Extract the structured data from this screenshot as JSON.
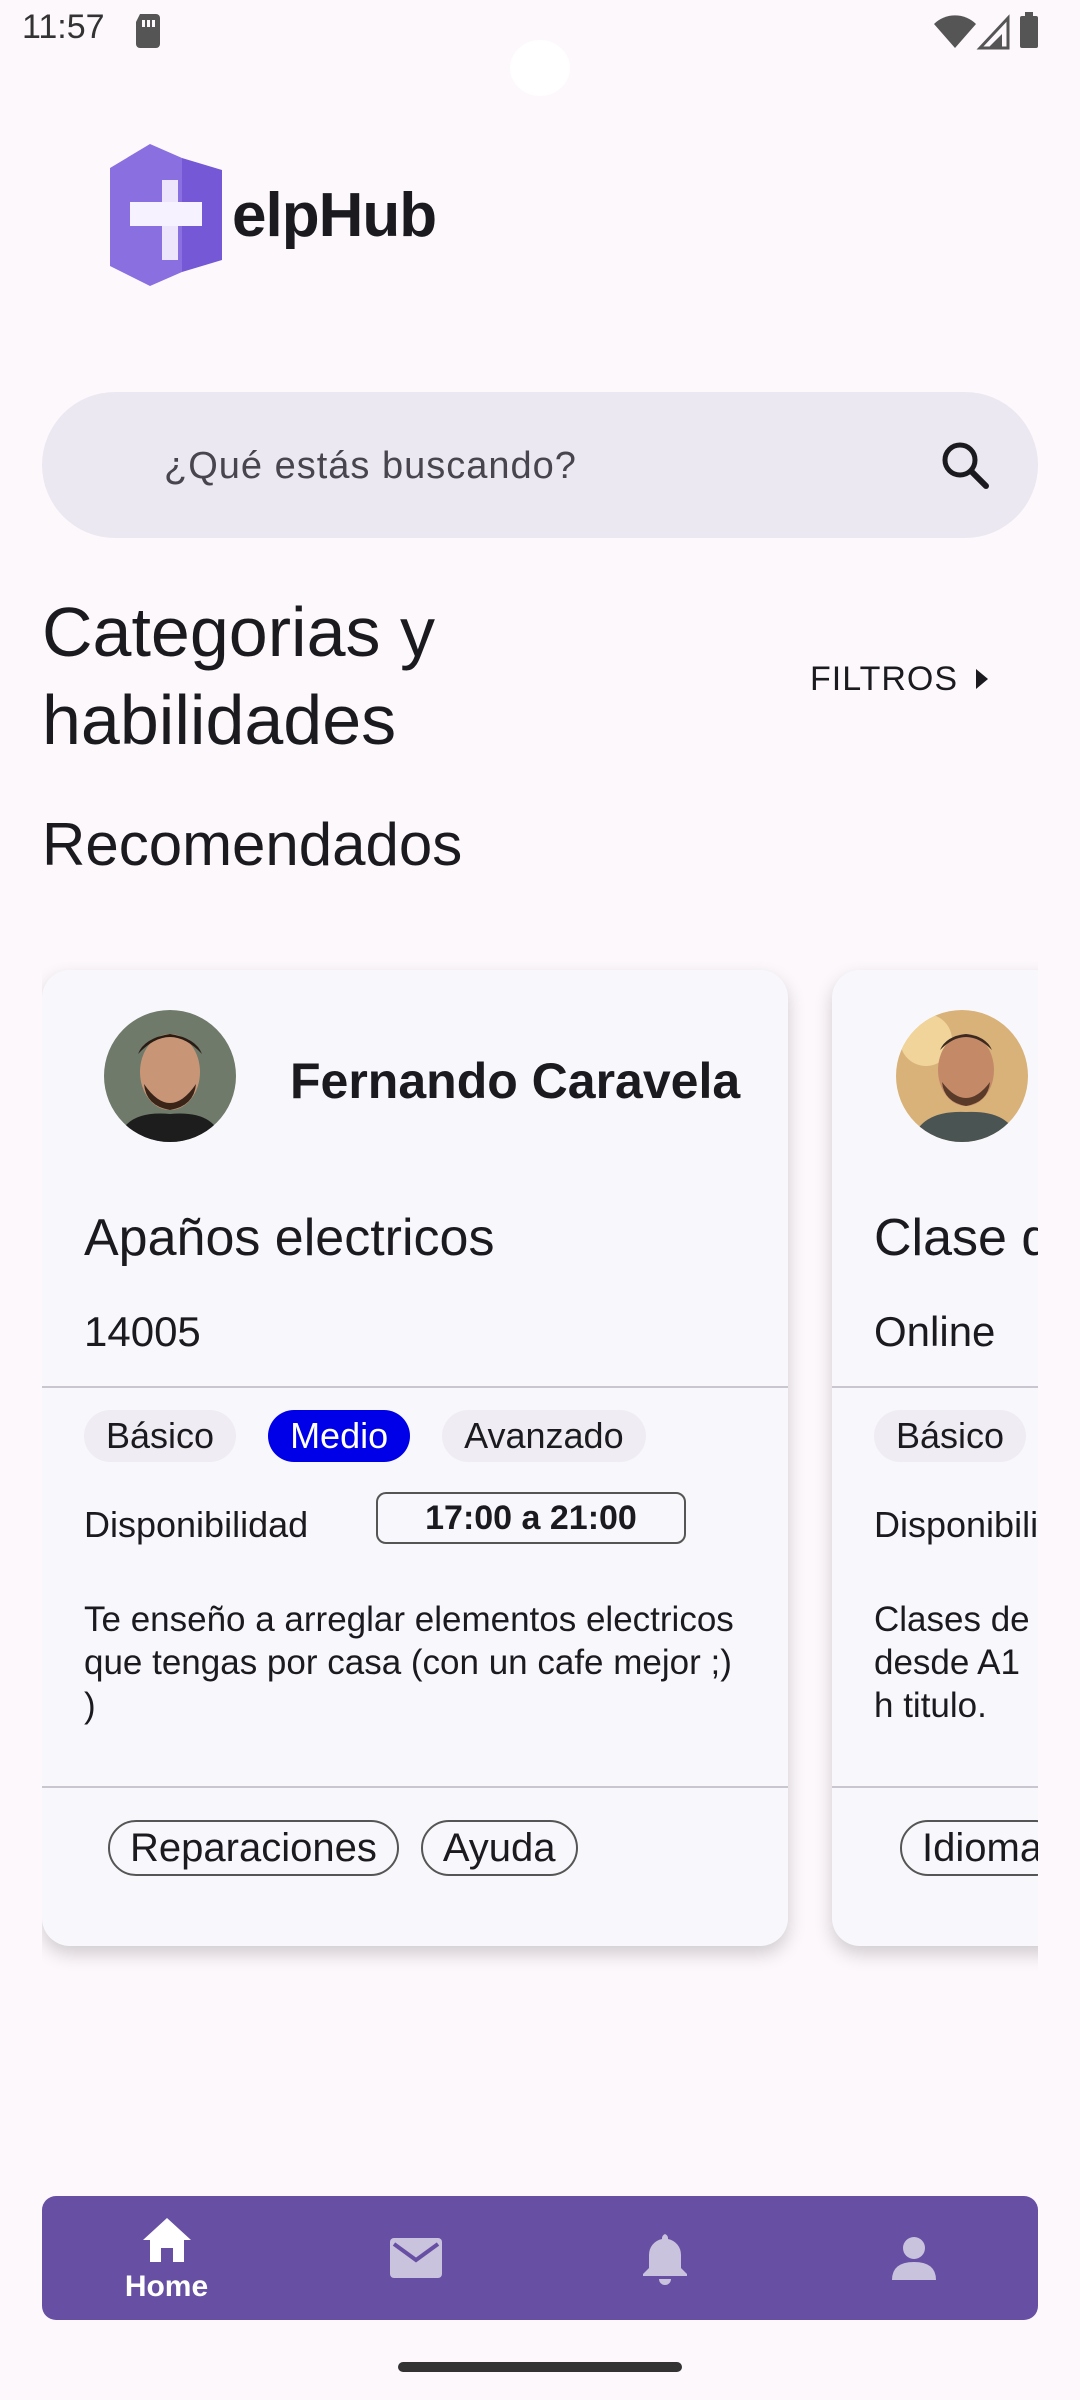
{
  "status_bar": {
    "time": "11:57"
  },
  "logo": {
    "text": "elpHub",
    "brand_color": "#8a6fe0"
  },
  "search": {
    "placeholder": "¿Qué estás buscando?"
  },
  "section": {
    "title": "Categorias y habilidades",
    "filters_label": "FILTROS"
  },
  "recommended": {
    "title": "Recomendados"
  },
  "cards": [
    {
      "name": "Fernando Caravela",
      "title": "Apaños electricos",
      "location": "14005",
      "levels": [
        "Básico",
        "Medio",
        "Avanzado"
      ],
      "active_level": "Medio",
      "availability_label": "Disponibilidad",
      "availability": "17:00 a 21:00",
      "description": "Te enseño a arreglar elementos electricos que tengas por casa (con un cafe mejor ;) )",
      "tags": [
        "Reparaciones",
        "Ayuda"
      ]
    },
    {
      "title": "Clase d",
      "location": "Online",
      "levels": [
        "Básico"
      ],
      "availability_label": "Disponibili",
      "description": "Clases de desde A1 h titulo.",
      "tags": [
        "Idioma"
      ]
    }
  ],
  "bottom_nav": {
    "items": [
      {
        "label": "Home",
        "icon": "home-icon",
        "active": true
      },
      {
        "label": "",
        "icon": "mail-icon"
      },
      {
        "label": "",
        "icon": "bell-icon"
      },
      {
        "label": "",
        "icon": "person-icon"
      }
    ],
    "color": "#6750a4"
  },
  "colors": {
    "active_level": "#0000e8",
    "search_bg": "#ece8f1",
    "background": "#fdf8fc"
  }
}
